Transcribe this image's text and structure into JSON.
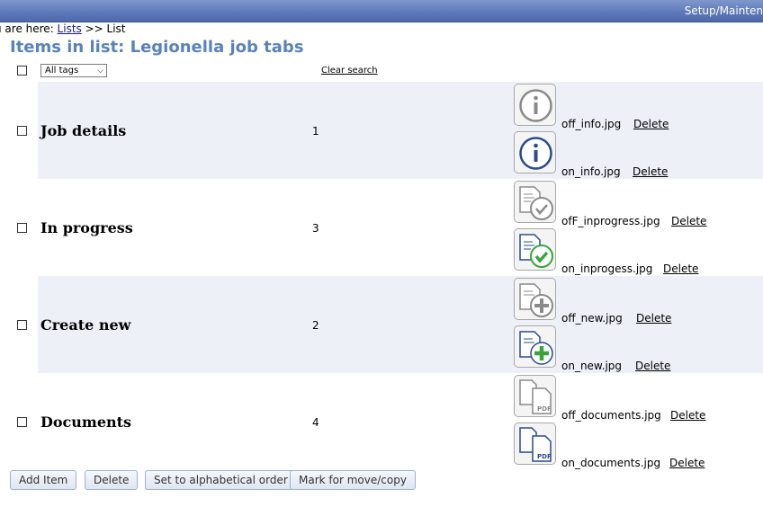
{
  "topbar": {
    "crumb": "Setup/Mainten"
  },
  "breadcrumb": {
    "prefix": "u are here: ",
    "link": "Lists",
    "sep": " >> ",
    "current": "List"
  },
  "page_title": "Items in list: Legionella job tabs",
  "filters": {
    "tags_selected": "All tags",
    "clear_search": "Clear search"
  },
  "items": [
    {
      "name": "Job details",
      "order": "1",
      "images": [
        {
          "icon": "info-off-icon",
          "file": "off_info.jpg",
          "action": "Delete"
        },
        {
          "icon": "info-on-icon",
          "file": "on_info.jpg",
          "action": "Delete"
        }
      ]
    },
    {
      "name": "In progress",
      "order": "3",
      "images": [
        {
          "icon": "inprogress-off-icon",
          "file": "ofF_inprogress.jpg",
          "action": "Delete"
        },
        {
          "icon": "inprogress-on-icon",
          "file": "on_inprogess.jpg",
          "action": "Delete"
        }
      ]
    },
    {
      "name": "Create new",
      "order": "2",
      "images": [
        {
          "icon": "new-off-icon",
          "file": "off_new.jpg",
          "action": "Delete"
        },
        {
          "icon": "new-on-icon",
          "file": "on_new.jpg",
          "action": "Delete"
        }
      ]
    },
    {
      "name": "Documents",
      "order": "4",
      "images": [
        {
          "icon": "documents-off-icon",
          "file": "off_documents.jpg",
          "action": "Delete"
        },
        {
          "icon": "documents-on-icon",
          "file": "on_documents.jpg",
          "action": "Delete"
        }
      ]
    }
  ],
  "buttons": {
    "add": "Add Item",
    "delete": "Delete",
    "alpha": "Set to alphabetical order",
    "move": "Mark for move/copy"
  },
  "colors": {
    "header_blue": "#5d78b8",
    "title_blue": "#5a82bd",
    "row_shade": "#eef0f8",
    "icon_on": "#2b4a8f",
    "icon_off": "#8a8a8a",
    "check_green": "#3aa53a"
  }
}
